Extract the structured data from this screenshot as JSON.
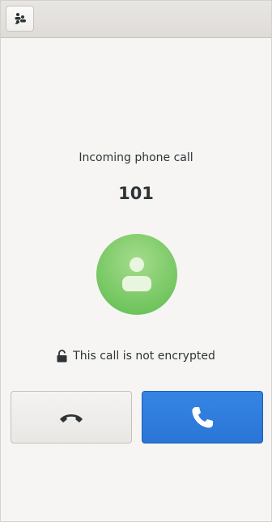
{
  "headerbar": {
    "dialpad_button_icon": "dialpad-icon"
  },
  "call": {
    "status_text": "Incoming phone call",
    "caller_number": "101",
    "avatar_icon": "person-icon",
    "encryption_text": "This call is not encrypted",
    "encryption_icon": "lock-icon"
  },
  "actions": {
    "decline_icon": "hangup-icon",
    "accept_icon": "phone-icon"
  },
  "colors": {
    "accept_button": "#3584e4",
    "avatar": "#7ec86a",
    "window_background": "#f6f5f4"
  }
}
